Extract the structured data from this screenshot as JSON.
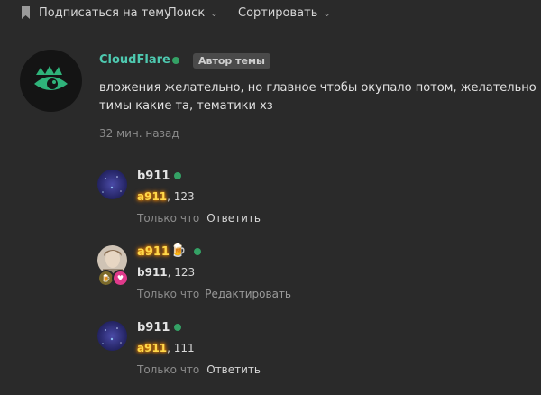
{
  "toolbar": {
    "subscribe_label": "Подписаться на тему",
    "search_label": "Поиск",
    "sort_label": "Сортировать"
  },
  "post": {
    "author": "CloudFlare",
    "author_color": "#4ec9b0",
    "badge": "Автор темы",
    "text_line1": "вложения желательно, но главное чтобы окупало потом, желательно не сиды",
    "text_line2": "тимы какие та, тематики хз",
    "time": "32 мин. назад"
  },
  "replies": [
    {
      "author": "b911",
      "mention": "a911",
      "text": ", 123",
      "time": "Только что",
      "action": "Ответить"
    },
    {
      "author": "a911",
      "mention": "b911",
      "text": ", 123",
      "time": "Только что",
      "action": "Редактировать"
    },
    {
      "author": "b911",
      "mention": "a911",
      "text": ", 111",
      "time": "Только что",
      "action": "Ответить"
    }
  ],
  "colors": {
    "background": "#2a2a2a",
    "online": "#34a165",
    "mention_gold": "#ffd84a"
  }
}
